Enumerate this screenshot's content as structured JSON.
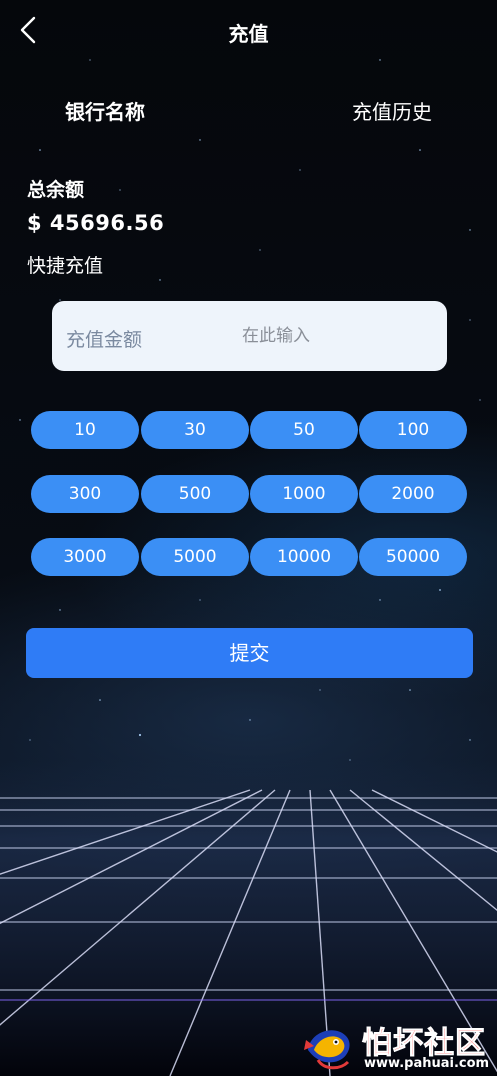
{
  "header": {
    "title": "充值",
    "back_icon": "chevron-left-icon"
  },
  "tabs": {
    "bank": "银行名称",
    "history": "充值历史"
  },
  "balance": {
    "label": "总余额",
    "value": "$ 45696.56"
  },
  "quick": {
    "label": "快捷充值"
  },
  "amount": {
    "label": "充值金额",
    "placeholder": "在此输入",
    "value": ""
  },
  "presets": [
    "10",
    "30",
    "50",
    "100",
    "300",
    "500",
    "1000",
    "2000",
    "3000",
    "5000",
    "10000",
    "50000"
  ],
  "submit": {
    "label": "提交"
  },
  "watermark": {
    "title": "怕坏社区",
    "url": "www.pahuai.com"
  },
  "colors": {
    "preset_button": "#3b8ff5",
    "submit_button": "#2f7cf6",
    "input_background": "#eef4fb",
    "watermark_red": "#ff2a2a"
  }
}
